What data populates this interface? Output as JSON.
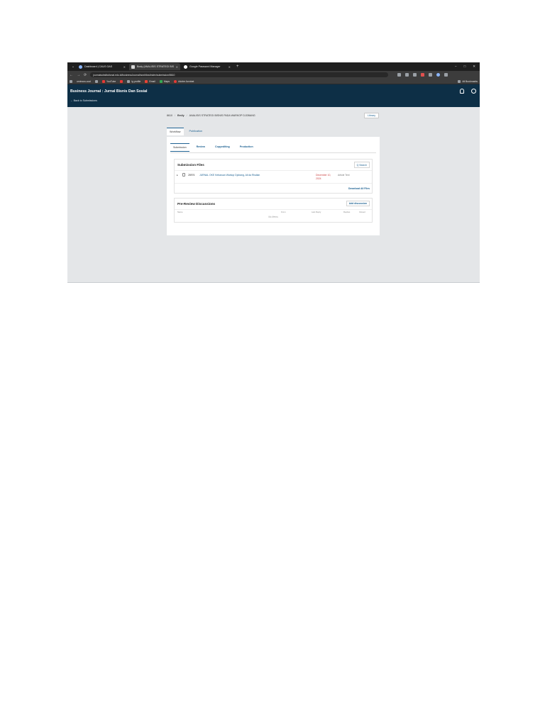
{
  "browser": {
    "tab_menu": "⌄",
    "tabs": [
      {
        "title": "Dashboard | CAUS GAS",
        "active": false
      },
      {
        "title": "Body (ANALISIS STRATEGI BIS",
        "active": true
      },
      {
        "title": "Google Password Manager",
        "active": false
      }
    ],
    "new_tab": "+",
    "window_controls": [
      "–",
      "□",
      "✕"
    ],
    "url": "journalsubstitutional.edu.id/businessJournal/workflow/index/submission/8610",
    "bookmarks": [
      {
        "label": "",
        "icon": "apps-icon"
      },
      {
        "label": "ominous.cool",
        "icon": "bookmark-icon"
      },
      {
        "label": "",
        "icon": "globe-icon"
      },
      {
        "label": "YouTube",
        "icon": "youtube-icon"
      },
      {
        "label": "",
        "icon": "bookmark-icon"
      },
      {
        "label": "Ig profile",
        "icon": "bookmark-icon"
      },
      {
        "label": "Email",
        "icon": "mail-icon"
      },
      {
        "label": "Maps",
        "icon": "map-icon"
      },
      {
        "label": "Adobe Acrobat",
        "icon": "adobe-icon"
      }
    ],
    "all_bookmarks": "All Bookmarks"
  },
  "header": {
    "journal_title": "Business Journal : Jurnal Bisnis Dan Sosial",
    "back_link": "← Back to Submissions"
  },
  "breadcrumb": {
    "id": "8610",
    "author": "Emily",
    "title": "ANALISIS STRATEGI BISNIS PADA WARKOP DJOBANG"
  },
  "library_button": "Library",
  "main_tabs": [
    "Workflow",
    "Publication"
  ],
  "stage_tabs": [
    "Submission",
    "Review",
    "Copyediting",
    "Production"
  ],
  "submission_files": {
    "title": "Submission Files",
    "search_label": "Q Search",
    "files": [
      {
        "id": "28976",
        "name": "JURNAL OKE Kebaruan Warkop Djobang, Ali da Risdian",
        "date": "December 10, 2024",
        "type": "Article Text"
      }
    ],
    "download_all": "Download All Files"
  },
  "discussions": {
    "title": "Pre-Review Discussions",
    "add_label": "Add discussion",
    "columns": [
      "Name",
      "From",
      "Last Reply",
      "Replies",
      "Closed"
    ],
    "empty_text": "No Items"
  }
}
